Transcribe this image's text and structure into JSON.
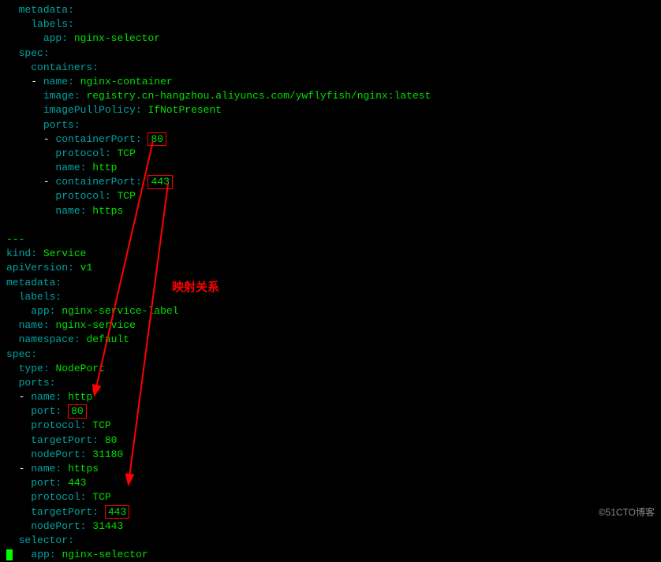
{
  "pod": {
    "metadata_key": "metadata",
    "labels_key": "labels",
    "app_key": "app",
    "app_val": "nginx-selector",
    "spec_key": "spec",
    "containers_key": "containers",
    "name_key": "name",
    "container_name": "nginx-container",
    "image_key": "image",
    "image_val": "registry.cn-hangzhou.aliyuncs.com/ywflyfish/nginx:latest",
    "imagePullPolicy_key": "imagePullPolicy",
    "imagePullPolicy_val": "IfNotPresent",
    "ports_key": "ports",
    "containerPort_key": "containerPort",
    "port80": "80",
    "protocol_key": "protocol",
    "protocol_val": "TCP",
    "http": "http",
    "port443": "443",
    "https": "https"
  },
  "sep": "---",
  "svc": {
    "kind_key": "kind",
    "kind_val": "Service",
    "apiVersion_key": "apiVersion",
    "apiVersion_val": "v1",
    "metadata_key": "metadata",
    "labels_key": "labels",
    "app_key": "app",
    "app_val": "nginx-service-label",
    "name_key": "name",
    "name_val": "nginx-service",
    "namespace_key": "namespace",
    "namespace_val": "default",
    "spec_key": "spec",
    "type_key": "type",
    "type_val": "NodePort",
    "ports_key": "ports",
    "port_key": "port",
    "port80": "80",
    "protocol_key": "protocol",
    "protocol_tcp": "TCP",
    "targetPort_key": "targetPort",
    "targetPort80": "80",
    "nodePort_key": "nodePort",
    "nodePort80": "31180",
    "https": "https",
    "port443": "443",
    "targetPort443": "443",
    "nodePort443": "31443",
    "selector_key": "selector",
    "selector_app_key": "app",
    "selector_app_val": "nginx-selector",
    "http": "http"
  },
  "annotation": "映射关系",
  "watermark": "©51CTO博客",
  "colors": {
    "key": "#00a3a3",
    "value": "#00e000",
    "highlight": "#ff0000",
    "bg": "#000000"
  }
}
